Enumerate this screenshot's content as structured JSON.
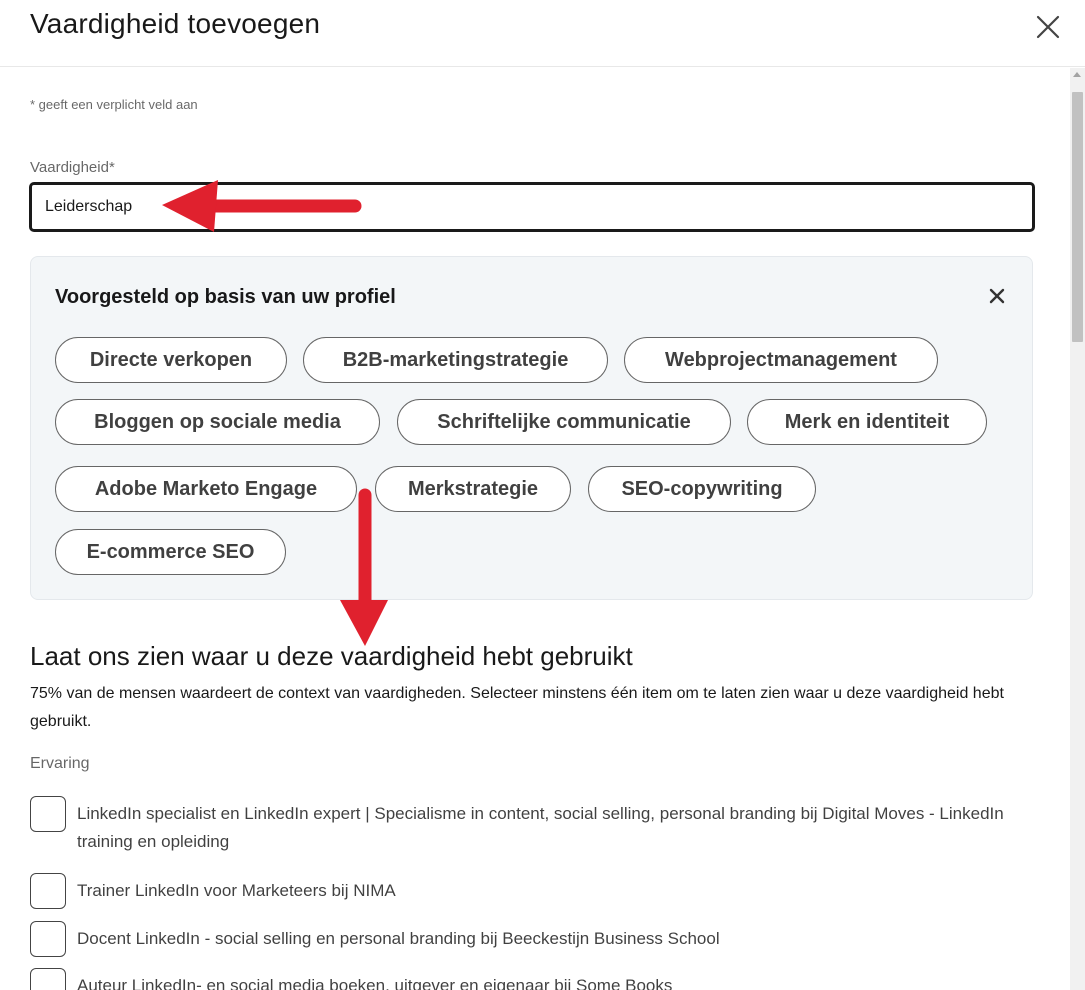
{
  "dialog": {
    "title": "Vaardigheid toevoegen",
    "close_icon": "close-icon"
  },
  "form": {
    "required_note": "* geeft een verplicht veld aan",
    "skill_label": "Vaardigheid*",
    "skill_value": "Leiderschap"
  },
  "suggestions": {
    "title": "Voorgesteld op basis van uw profiel",
    "close_icon": "close-icon",
    "items": [
      "Directe verkopen",
      "B2B-marketingstrategie",
      "Webprojectmanagement",
      "Bloggen op sociale media",
      "Schriftelijke communicatie",
      "Merk en identiteit",
      "Adobe Marketo Engage",
      "Merkstrategie",
      "SEO-copywriting",
      "E-commerce SEO"
    ]
  },
  "context": {
    "heading": "Laat ons zien waar u deze vaardigheid hebt gebruikt",
    "description": "75% van de mensen waardeert de context van vaardigheden. Selecteer minstens één item om te laten zien waar u deze vaardigheid hebt gebruikt.",
    "group_label": "Ervaring",
    "experience": [
      "LinkedIn specialist en LinkedIn expert | Specialisme in content, social selling, personal branding bij Digital Moves - LinkedIn training en opleiding",
      "Trainer LinkedIn voor Marketeers bij NIMA",
      "Docent LinkedIn - social selling en personal branding bij Beeckestijn Business School",
      "Auteur LinkedIn- en social media boeken, uitgever en eigenaar bij Some Books"
    ]
  },
  "colors": {
    "annotation_arrow": "#e0212e",
    "suggest_bg": "#f3f6f8",
    "input_border": "#1a1a1a"
  }
}
